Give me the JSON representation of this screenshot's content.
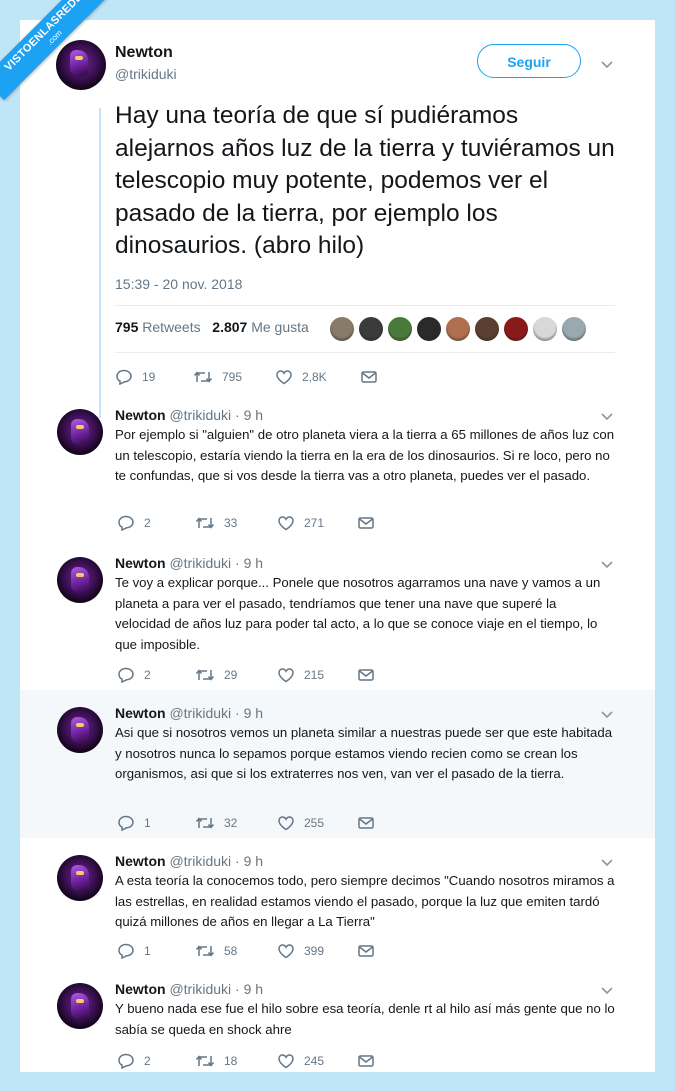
{
  "watermark": {
    "line1": "VISTOENLASREDES",
    "line2": ".com"
  },
  "main": {
    "name": "Newton",
    "handle": "@trikiduki",
    "follow_label": "Seguir",
    "text": "Hay una teoría de que sí pudiéramos alejarnos años luz de la tierra y tuviéramos un telescopio muy potente, podemos ver el pasado de la tierra, por ejemplo los dinosaurios. (abro hilo)",
    "timestamp": "15:39 - 20 nov. 2018",
    "retweets_count": "795",
    "retweets_label": "Retweets",
    "likes_count": "2.807",
    "likes_label": "Me gusta",
    "replies": "19",
    "rts": "795",
    "favs": "2,8K",
    "liker_colors": [
      "#8a7a6a",
      "#3b3b3b",
      "#4a7a3a",
      "#2a2a2a",
      "#b07050",
      "#5a4030",
      "#8a1a1a",
      "#d8d8d8",
      "#9aa8b0"
    ]
  },
  "replies": [
    {
      "name": "Newton",
      "handle": "@trikiduki",
      "sep": "·",
      "time": "9 h",
      "text": "Por ejemplo si \"alguien\" de otro planeta viera a la tierra a 65 millones de años luz con un telescopio, estaría viendo la tierra en la era de los dinosaurios. Si re loco, pero no te confundas, que si vos desde la tierra vas a  otro planeta, puedes ver el pasado.",
      "replies": "2",
      "rts": "33",
      "favs": "271"
    },
    {
      "name": "Newton",
      "handle": "@trikiduki",
      "sep": "·",
      "time": "9 h",
      "text": "Te voy a explicar porque... Ponele que nosotros agarramos una nave y vamos a un planeta a para ver el pasado, tendríamos que tener una nave que superé la velocidad de años luz para poder tal acto, a lo que se conoce viaje en el tiempo, lo que imposible.",
      "replies": "2",
      "rts": "29",
      "favs": "215"
    },
    {
      "name": "Newton",
      "handle": "@trikiduki",
      "sep": "·",
      "time": "9 h",
      "text": "Asi que si nosotros vemos un planeta similar a nuestras puede ser que este habitada y nosotros nunca lo sepamos porque estamos viendo recien como se crean los organismos, asi que si los extraterres nos ven, van ver el pasado de la tierra.",
      "replies": "1",
      "rts": "32",
      "favs": "255"
    },
    {
      "name": "Newton",
      "handle": "@trikiduki",
      "sep": "·",
      "time": "9 h",
      "text": "A esta teoría la conocemos todo, pero siempre decimos \"Cuando nosotros miramos a las estrellas, en realidad estamos viendo el pasado, porque la luz que emiten tardó quizá millones de años en llegar a La Tierra\"",
      "replies": "1",
      "rts": "58",
      "favs": "399"
    },
    {
      "name": "Newton",
      "handle": "@trikiduki",
      "sep": "·",
      "time": "9 h",
      "text": "Y bueno nada ese fue el hilo sobre esa teoría, denle rt al hilo así más gente que no lo sabía se queda en shock ahre",
      "replies": "2",
      "rts": "18",
      "favs": "245"
    }
  ]
}
